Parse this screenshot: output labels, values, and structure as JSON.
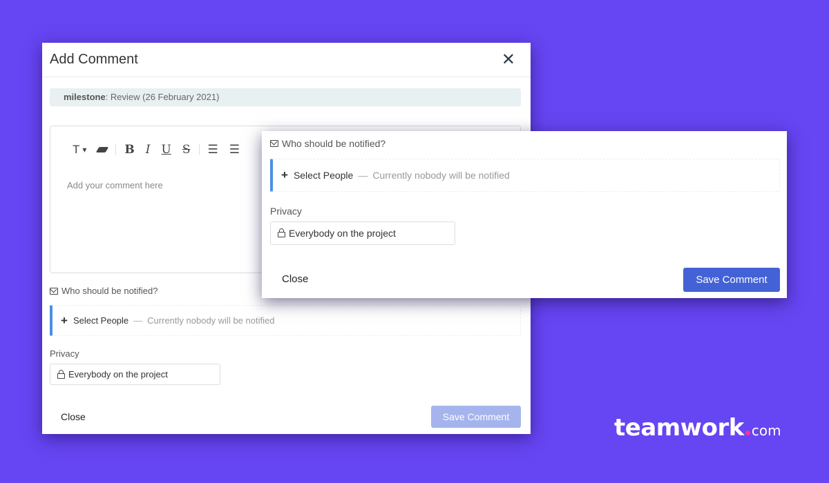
{
  "main_modal": {
    "title": "Add Comment",
    "close_icon": "close-icon",
    "milestone": {
      "label": "milestone",
      "value": ": Review (26 February 2021)"
    },
    "editor": {
      "toolbar": {
        "text_style": "T",
        "chevron": "⌄",
        "bold": "B",
        "italic": "I",
        "underline": "U",
        "strike": "S",
        "bullet_list": "☰",
        "numbered_list": "☰"
      },
      "placeholder": "Add your comment here"
    },
    "notify_label": "Who should be notified?",
    "select_people": {
      "label": "Select People",
      "dash": "—",
      "hint": "Currently nobody will be notified"
    },
    "privacy_label": "Privacy",
    "privacy_value": "Everybody on the project",
    "close_button": "Close",
    "save_button": "Save Comment",
    "save_disabled": true
  },
  "overlay_modal": {
    "notify_label": "Who should be notified?",
    "select_people": {
      "label": "Select People",
      "dash": "—",
      "hint": "Currently nobody will be notified"
    },
    "privacy_label": "Privacy",
    "privacy_value": "Everybody on the project",
    "close_button": "Close",
    "save_button": "Save Comment"
  },
  "branding": {
    "word": "teamwork",
    "tld": "com",
    "dot_color": "#ff2fa0"
  },
  "colors": {
    "background": "#6645f2",
    "primary": "#4362d6",
    "primary_disabled": "#a5b4ed",
    "accent_border": "#4a90e2"
  }
}
